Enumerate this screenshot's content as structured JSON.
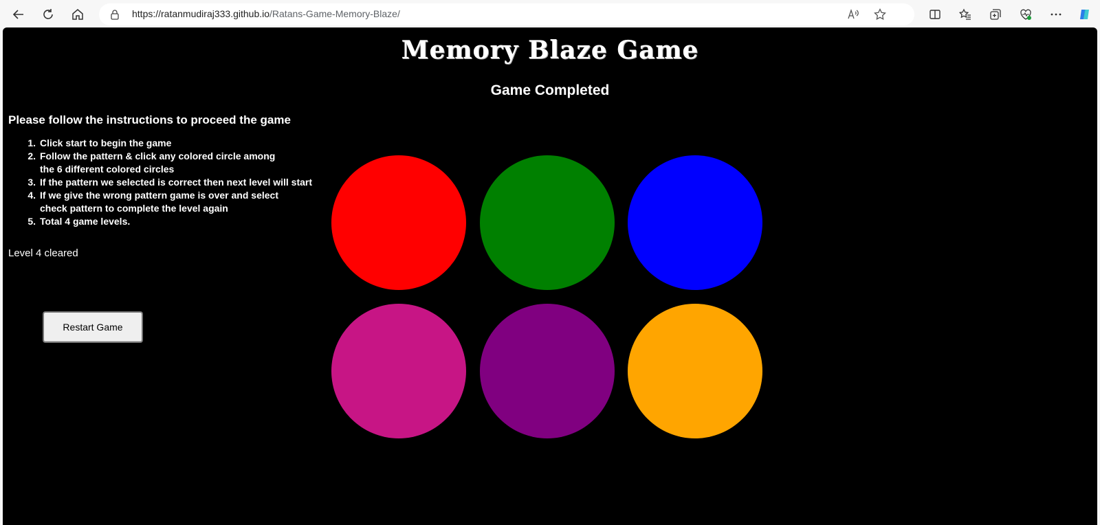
{
  "browser": {
    "url_host": "https://ratanmudiraj333.github.io",
    "url_path": "/Ratans-Game-Memory-Blaze/"
  },
  "game": {
    "title": "Memory Blaze Game",
    "status": "Game Completed",
    "level_text": "Level 4 cleared",
    "restart_label": "Restart Game"
  },
  "instructions": {
    "heading": "Please follow the instructions to proceed the game",
    "items": [
      {
        "num": "1.",
        "text": "Click start to begin the game"
      },
      {
        "num": "2.",
        "text": "Follow the pattern & click any colored circle among the 6 different colored circles"
      },
      {
        "num": "3.",
        "text": "If the pattern we selected is correct then next level will start"
      },
      {
        "num": "4.",
        "text": "If we give the wrong pattern game is over and select check pattern to complete the level again"
      },
      {
        "num": "5.",
        "text": "Total 4 game levels."
      }
    ]
  },
  "circles": [
    {
      "name": "red",
      "color": "#ff0000"
    },
    {
      "name": "green",
      "color": "#008000"
    },
    {
      "name": "blue",
      "color": "#0000ff"
    },
    {
      "name": "pink",
      "color": "#c71585"
    },
    {
      "name": "purple",
      "color": "#800080"
    },
    {
      "name": "orange",
      "color": "#ffa500"
    }
  ]
}
